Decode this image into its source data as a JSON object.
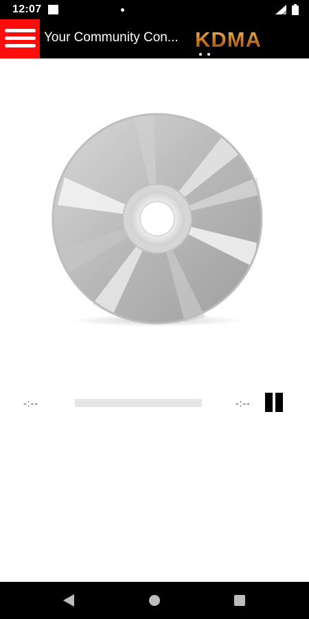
{
  "status_bar": {
    "time": "12:07",
    "icons": [
      "notification-square-icon",
      "dot-icon",
      "signal-icon",
      "battery-icon"
    ]
  },
  "app_bar": {
    "menu_icon": "hamburger-menu-icon",
    "title": "Your Community Con...",
    "logo_text": "KDMA",
    "colors": {
      "menu_background": "#ff0d0d",
      "bar_background": "#000000",
      "logo": "#e08a2c"
    }
  },
  "player": {
    "artwork_icon": "cd-disc-icon",
    "elapsed": "-:--",
    "duration": "-:--",
    "progress": 0,
    "control_icon": "pause-icon"
  },
  "nav_bar": {
    "items": [
      "back-icon",
      "home-icon",
      "recents-icon"
    ]
  }
}
